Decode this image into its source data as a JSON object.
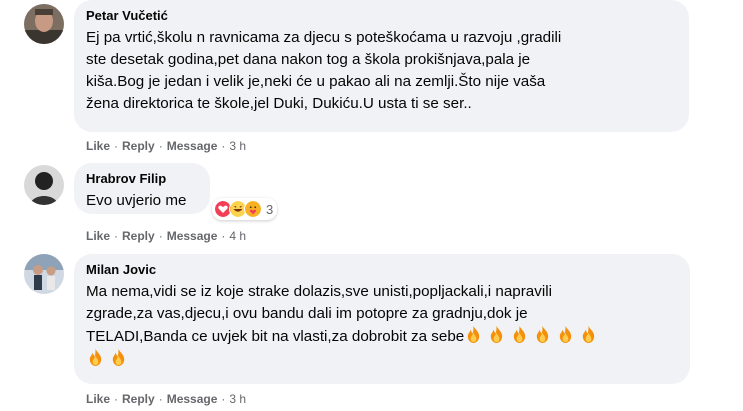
{
  "comments": [
    {
      "author": "Petar Vučetić",
      "lines": [
        "Ej pa vrtić,školu n ravnicama za djecu s poteškoćama u razvoju ,gradili",
        "ste desetak godina,pet dana nakon tog a škola prokišnjava,pala je",
        "kiša.Bog je jedan i velik je,neki će u pakao ali na zemlji.Što nije vaša",
        "žena direktorica te škole,jel Duki, Dukiću.U usta ti se ser.."
      ],
      "actions": {
        "like": "Like",
        "reply": "Reply",
        "message": "Message",
        "time": "3 h"
      }
    },
    {
      "author": "Hrabrov Filip",
      "lines": [
        "Evo uvjerio me"
      ],
      "reactions": {
        "count": "3",
        "icons": [
          "love-reaction-icon",
          "haha-reaction-icon",
          "care-reaction-icon"
        ]
      },
      "actions": {
        "like": "Like",
        "reply": "Reply",
        "message": "Message",
        "time": "4 h"
      }
    },
    {
      "author": "Milan Jovic",
      "lines": [
        "Ma nema,vidi se iz koje strake dolazis,sve unisti,popljackali,i napravili",
        "zgrade,za vas,djecu,i ovu bandu dali im potopre za gradnju,dok je",
        "TELADI,Banda ce uvjek bit na vlasti,za dobrobit za sebe"
      ],
      "emoji": "fire-emoji",
      "actions": {
        "like": "Like",
        "reply": "Reply",
        "message": "Message",
        "time": "3 h"
      }
    }
  ],
  "colors": {
    "bubble": "#f0f2f5",
    "meta": "#65676b",
    "text": "#050505"
  }
}
